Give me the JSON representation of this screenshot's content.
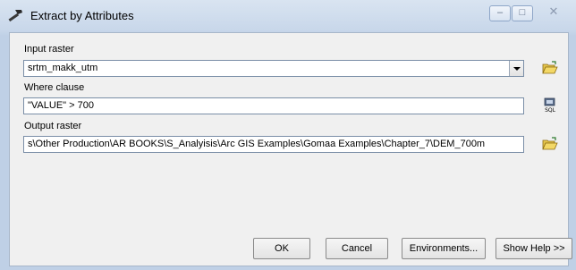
{
  "window": {
    "title": "Extract by Attributes",
    "buttons": {
      "minimize": "‒",
      "maximize": "□",
      "close": "✕"
    }
  },
  "form": {
    "input_raster": {
      "label": "Input raster",
      "value": "srtm_makk_utm"
    },
    "where_clause": {
      "label": "Where clause",
      "value": "\"VALUE\" > 700"
    },
    "output_raster": {
      "label": "Output raster",
      "value": "s\\Other Production\\AR BOOKS\\S_Analyisis\\Arc GIS Examples\\Gomaa Examples\\Chapter_7\\DEM_700m"
    }
  },
  "icons": {
    "title": "hammer-tool-icon",
    "browse_input": "folder-open-icon",
    "sql": "sql-icon",
    "browse_output": "folder-open-icon"
  },
  "footer": {
    "ok": "OK",
    "cancel": "Cancel",
    "environments": "Environments...",
    "show_help": "Show Help >>"
  }
}
